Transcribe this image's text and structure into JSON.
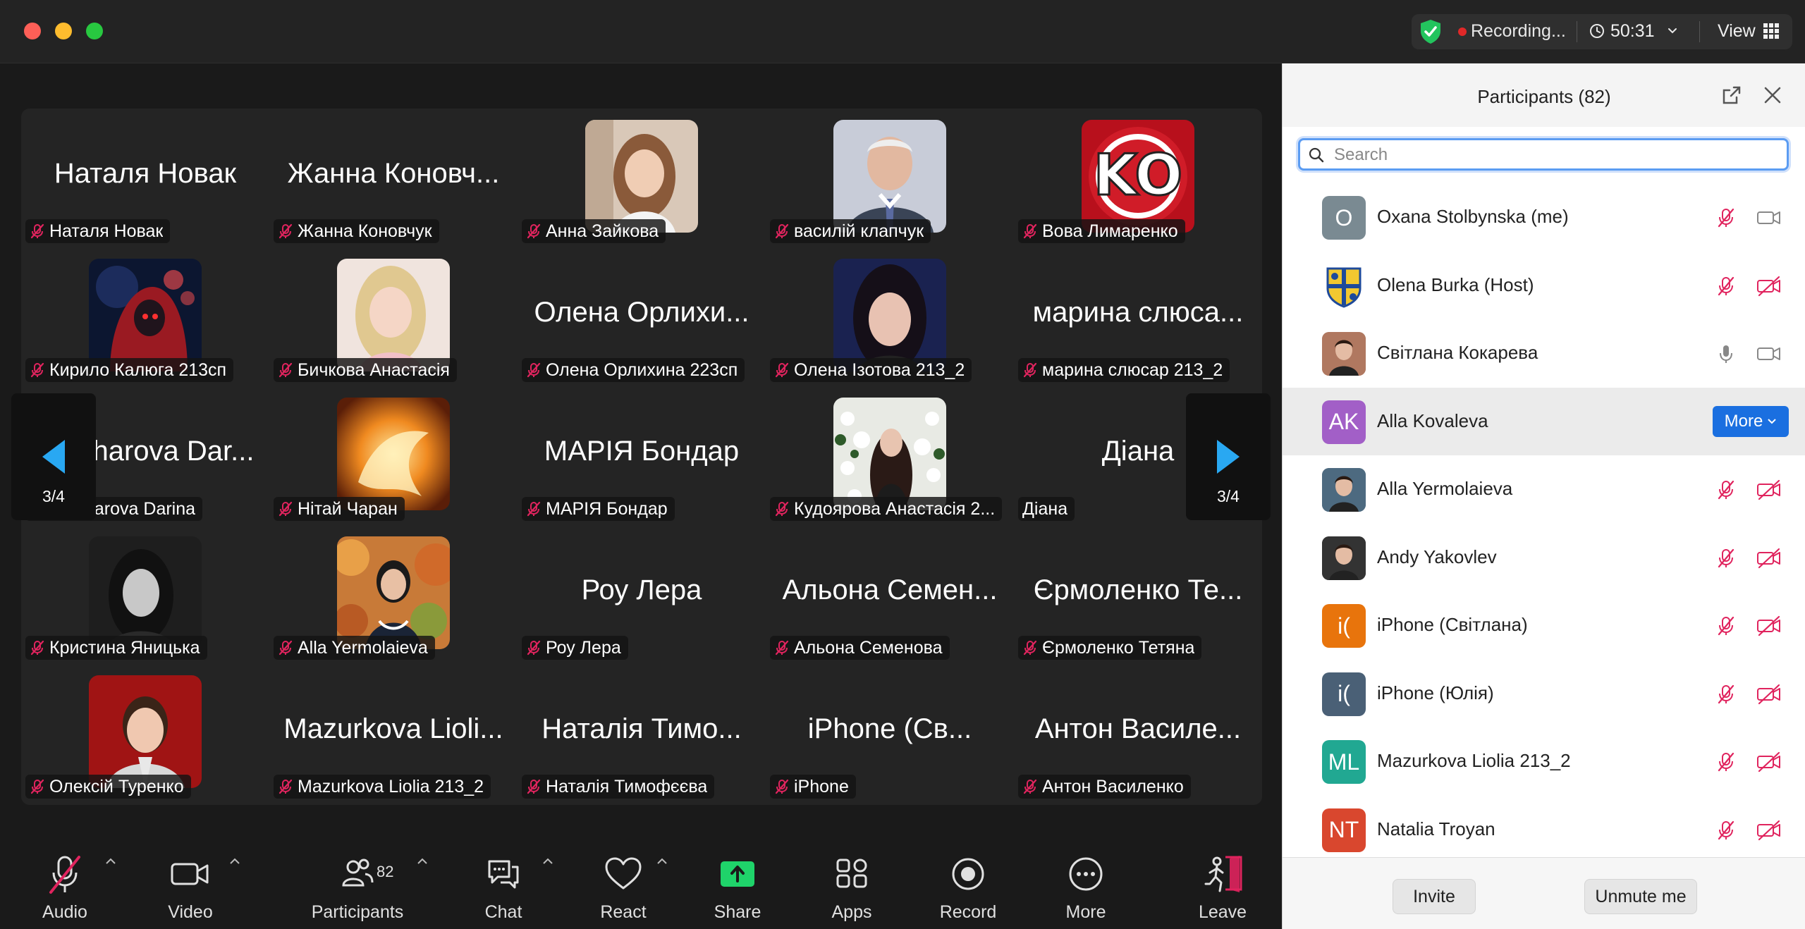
{
  "titlebar": {
    "recording": "Recording...",
    "time": "50:31",
    "view": "View"
  },
  "grid": {
    "page_indicator": "3/4",
    "tiles": [
      {
        "name": "Наталя Новак",
        "big": "Наталя Новак",
        "avatar": null
      },
      {
        "name": "Жанна Коновчук",
        "big": "Жанна Коновч...",
        "avatar": null
      },
      {
        "name": "Анна Зайкова",
        "big": null,
        "avatar": "photo-girl-light"
      },
      {
        "name": "василій  клапчук",
        "big": null,
        "avatar": "photo-old-man"
      },
      {
        "name": "Вова Лимаренко",
        "big": null,
        "avatar": "ko-logo"
      },
      {
        "name": "Кирило Калюга 213сп",
        "big": null,
        "avatar": "anime-dark"
      },
      {
        "name": "Бичкова Анастасія",
        "big": null,
        "avatar": "photo-blonde"
      },
      {
        "name": "Олена Орлихина 223сп",
        "big": "Олена Орлихи...",
        "avatar": null
      },
      {
        "name": "Олена Ізотова 213_2",
        "big": null,
        "avatar": "photo-dark-hair"
      },
      {
        "name": "марина слюсар 213_2",
        "big": "марина слюса...",
        "avatar": null
      },
      {
        "name": "Owcharova Darina",
        "big": "Owcharova Dar...",
        "avatar": null
      },
      {
        "name": "Нітай Чаран",
        "big": null,
        "avatar": "fire-art"
      },
      {
        "name": "МАРІЯ   Бондар",
        "big": "МАРІЯ   Бондар",
        "avatar": null
      },
      {
        "name": "Кудоярова Анастасія 2...",
        "big": null,
        "avatar": "photo-flowers"
      },
      {
        "name": "Діана",
        "big": "Діана",
        "avatar": null,
        "unmuted": true
      },
      {
        "name": "Кристина Яницька",
        "big": null,
        "avatar": "photo-bw"
      },
      {
        "name": "Alla Yermolaieva",
        "big": null,
        "avatar": "photo-autumn"
      },
      {
        "name": "Роу Лера",
        "big": "Роу Лера",
        "avatar": null
      },
      {
        "name": "Альона Семенова",
        "big": "Альона Семен...",
        "avatar": null
      },
      {
        "name": "Єрмоленко Тетяна",
        "big": "Єрмоленко Те...",
        "avatar": null
      },
      {
        "name": "Олексій  Туренко",
        "big": null,
        "avatar": "photo-red"
      },
      {
        "name": "Mazurkova Liolia 213_2",
        "big": "Mazurkova Lioli...",
        "avatar": null
      },
      {
        "name": "Наталія Тимофєєва",
        "big": "Наталія Тимо...",
        "avatar": null
      },
      {
        "name": "iPhone",
        "big": "iPhone (Св...",
        "avatar": null
      },
      {
        "name": "Антон Василенко",
        "big": "Антон Василе...",
        "avatar": null
      }
    ]
  },
  "toolbar": {
    "audio": "Audio",
    "video": "Video",
    "participants": "Participants",
    "participants_count": "82",
    "chat": "Chat",
    "react": "React",
    "share": "Share",
    "apps": "Apps",
    "record": "Record",
    "more": "More",
    "leave": "Leave"
  },
  "panel": {
    "title": "Participants (82)",
    "search_placeholder": "Search",
    "more_label": "More",
    "invite": "Invite",
    "unmute_me": "Unmute me",
    "participants": [
      {
        "name": "Oxana Stolbynska (me)",
        "initials": "O",
        "color": "#7a8a92",
        "mic": "muted",
        "cam": "on"
      },
      {
        "name": "Olena Burka (Host)",
        "initials": "",
        "color": "#ffffff",
        "avatar": "crest",
        "mic": "muted",
        "cam": "off"
      },
      {
        "name": "Світлана Кокарева",
        "initials": "",
        "color": "#b07860",
        "avatar": "photo",
        "mic": "on",
        "cam": "on"
      },
      {
        "name": "Alla Kovaleva",
        "initials": "AK",
        "color": "#a25fc7",
        "mic": "none",
        "cam": "none",
        "hover": true
      },
      {
        "name": "Alla Yermolaieva",
        "initials": "",
        "color": "#4d6a80",
        "avatar": "photo",
        "mic": "muted",
        "cam": "off"
      },
      {
        "name": "Andy Yakovlev",
        "initials": "",
        "color": "#333333",
        "avatar": "photo",
        "mic": "muted",
        "cam": "off"
      },
      {
        "name": "iPhone (Світлана)",
        "initials": "i(",
        "color": "#e8740c",
        "mic": "muted",
        "cam": "off"
      },
      {
        "name": "iPhone (Юлія)",
        "initials": "i(",
        "color": "#4a6076",
        "mic": "muted",
        "cam": "off"
      },
      {
        "name": "Mazurkova Liolia 213_2",
        "initials": "ML",
        "color": "#21a892",
        "mic": "muted",
        "cam": "off"
      },
      {
        "name": "Natalia Troyan",
        "initials": "NT",
        "color": "#d9472e",
        "mic": "muted",
        "cam": "off"
      }
    ]
  },
  "colors": {
    "muted_red": "#e0245e",
    "share_green": "#1fd36a",
    "accent_blue": "#1a6fe0"
  }
}
